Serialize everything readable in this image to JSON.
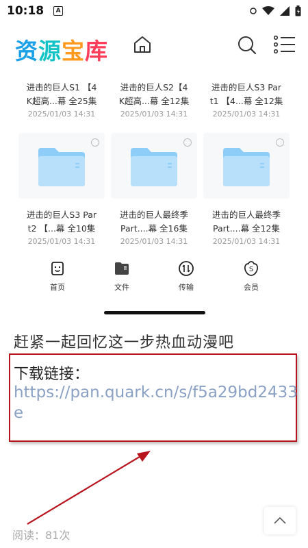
{
  "status_bar": {
    "time": "10:18",
    "notification_badge": "A"
  },
  "header": {
    "logo_chars": [
      "资",
      "源",
      "宝",
      "库"
    ],
    "logo_colors": [
      "#1aa0e6",
      "#14c3c6",
      "#ff9a1f",
      "#ff3d5a"
    ]
  },
  "files_row1": [
    {
      "name_line1": "进击的巨人S1 【4",
      "name_line2": "K超高...幕 全25集",
      "date": "2025/01/03 14:31"
    },
    {
      "name_line1": "进击的巨人S2【4",
      "name_line2": "K超高...幕 全12集",
      "date": "2025/01/03 14:31"
    },
    {
      "name_line1": "进击的巨人S3 Par",
      "name_line2": "t1 【4...幕 全12集",
      "date": "2025/01/03 14:31"
    }
  ],
  "files_row2": [
    {
      "name_line1": "进击的巨人S3 Par",
      "name_line2": "t2 【...幕 全10集",
      "date": "2025/01/03 14:31"
    },
    {
      "name_line1": "进击的巨人最终季",
      "name_line2": "Part....幕 全16集",
      "date": "2025/01/03 14:31"
    },
    {
      "name_line1": "进击的巨人最终季",
      "name_line2": "Part....幕 全12集",
      "date": "2025/01/03 14:31"
    }
  ],
  "tabbar": {
    "home": "首页",
    "files": "文件",
    "transfer": "传输",
    "member": "会员"
  },
  "article": {
    "title": "赶紧一起回忆这一步热血动漫吧",
    "download_label": "下载链接：",
    "download_link": "https://pan.quark.cn/s/f5a29bd2433e",
    "read_count": "阅读：81次"
  },
  "colors": {
    "accent_red": "#b8141e",
    "link": "#8aa1c4",
    "folder_blue": "#6fb8f2"
  }
}
